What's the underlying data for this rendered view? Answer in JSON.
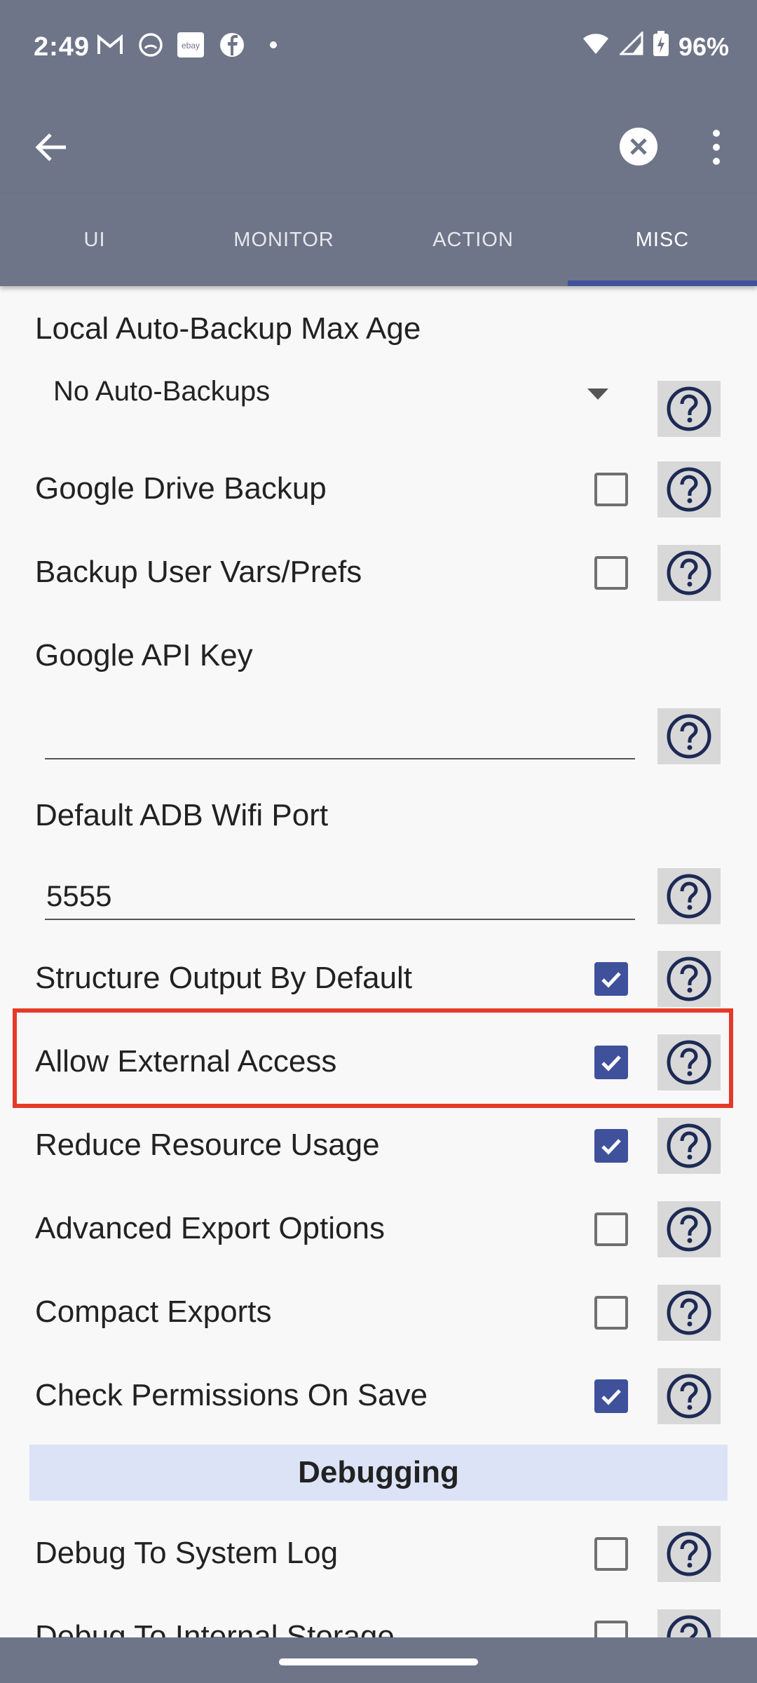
{
  "status_bar": {
    "time": "2:49",
    "battery": "96%",
    "notification_icons": [
      "gmail-icon",
      "app-icon",
      "ebay-icon",
      "facebook-icon",
      "dot-icon"
    ]
  },
  "toolbar": {
    "back_icon": "arrow-left-icon",
    "close_icon": "close-circle-icon",
    "menu_icon": "more-vert-icon"
  },
  "tabs": [
    {
      "label": "UI",
      "active": false
    },
    {
      "label": "MONITOR",
      "active": false
    },
    {
      "label": "ACTION",
      "active": false
    },
    {
      "label": "MISC",
      "active": true
    }
  ],
  "settings": {
    "backup_max_age": {
      "label": "Local Auto-Backup Max Age",
      "value": "No Auto-Backups"
    },
    "google_drive_backup": {
      "label": "Google Drive Backup",
      "checked": false
    },
    "backup_user_vars": {
      "label": "Backup User Vars/Prefs",
      "checked": false
    },
    "google_api_key": {
      "label": "Google API Key",
      "value": ""
    },
    "adb_wifi_port": {
      "label": "Default ADB Wifi Port",
      "value": "5555"
    },
    "structure_output": {
      "label": "Structure Output By Default",
      "checked": true
    },
    "allow_external_access": {
      "label": "Allow External Access",
      "checked": true
    },
    "reduce_resource_usage": {
      "label": "Reduce Resource Usage",
      "checked": true
    },
    "advanced_export_options": {
      "label": "Advanced Export Options",
      "checked": false
    },
    "compact_exports": {
      "label": "Compact Exports",
      "checked": false
    },
    "check_permissions_on_save": {
      "label": "Check Permissions On Save",
      "checked": true
    }
  },
  "debugging": {
    "section_title": "Debugging",
    "debug_system_log": {
      "label": "Debug To System Log",
      "checked": false
    },
    "debug_internal_storage": {
      "label": "Debug To Internal Storage",
      "checked": false
    }
  },
  "colors": {
    "header_bg": "#6f7588",
    "accent": "#3f519b",
    "highlight_border": "#e53a29",
    "section_bg": "#dde3f6"
  }
}
